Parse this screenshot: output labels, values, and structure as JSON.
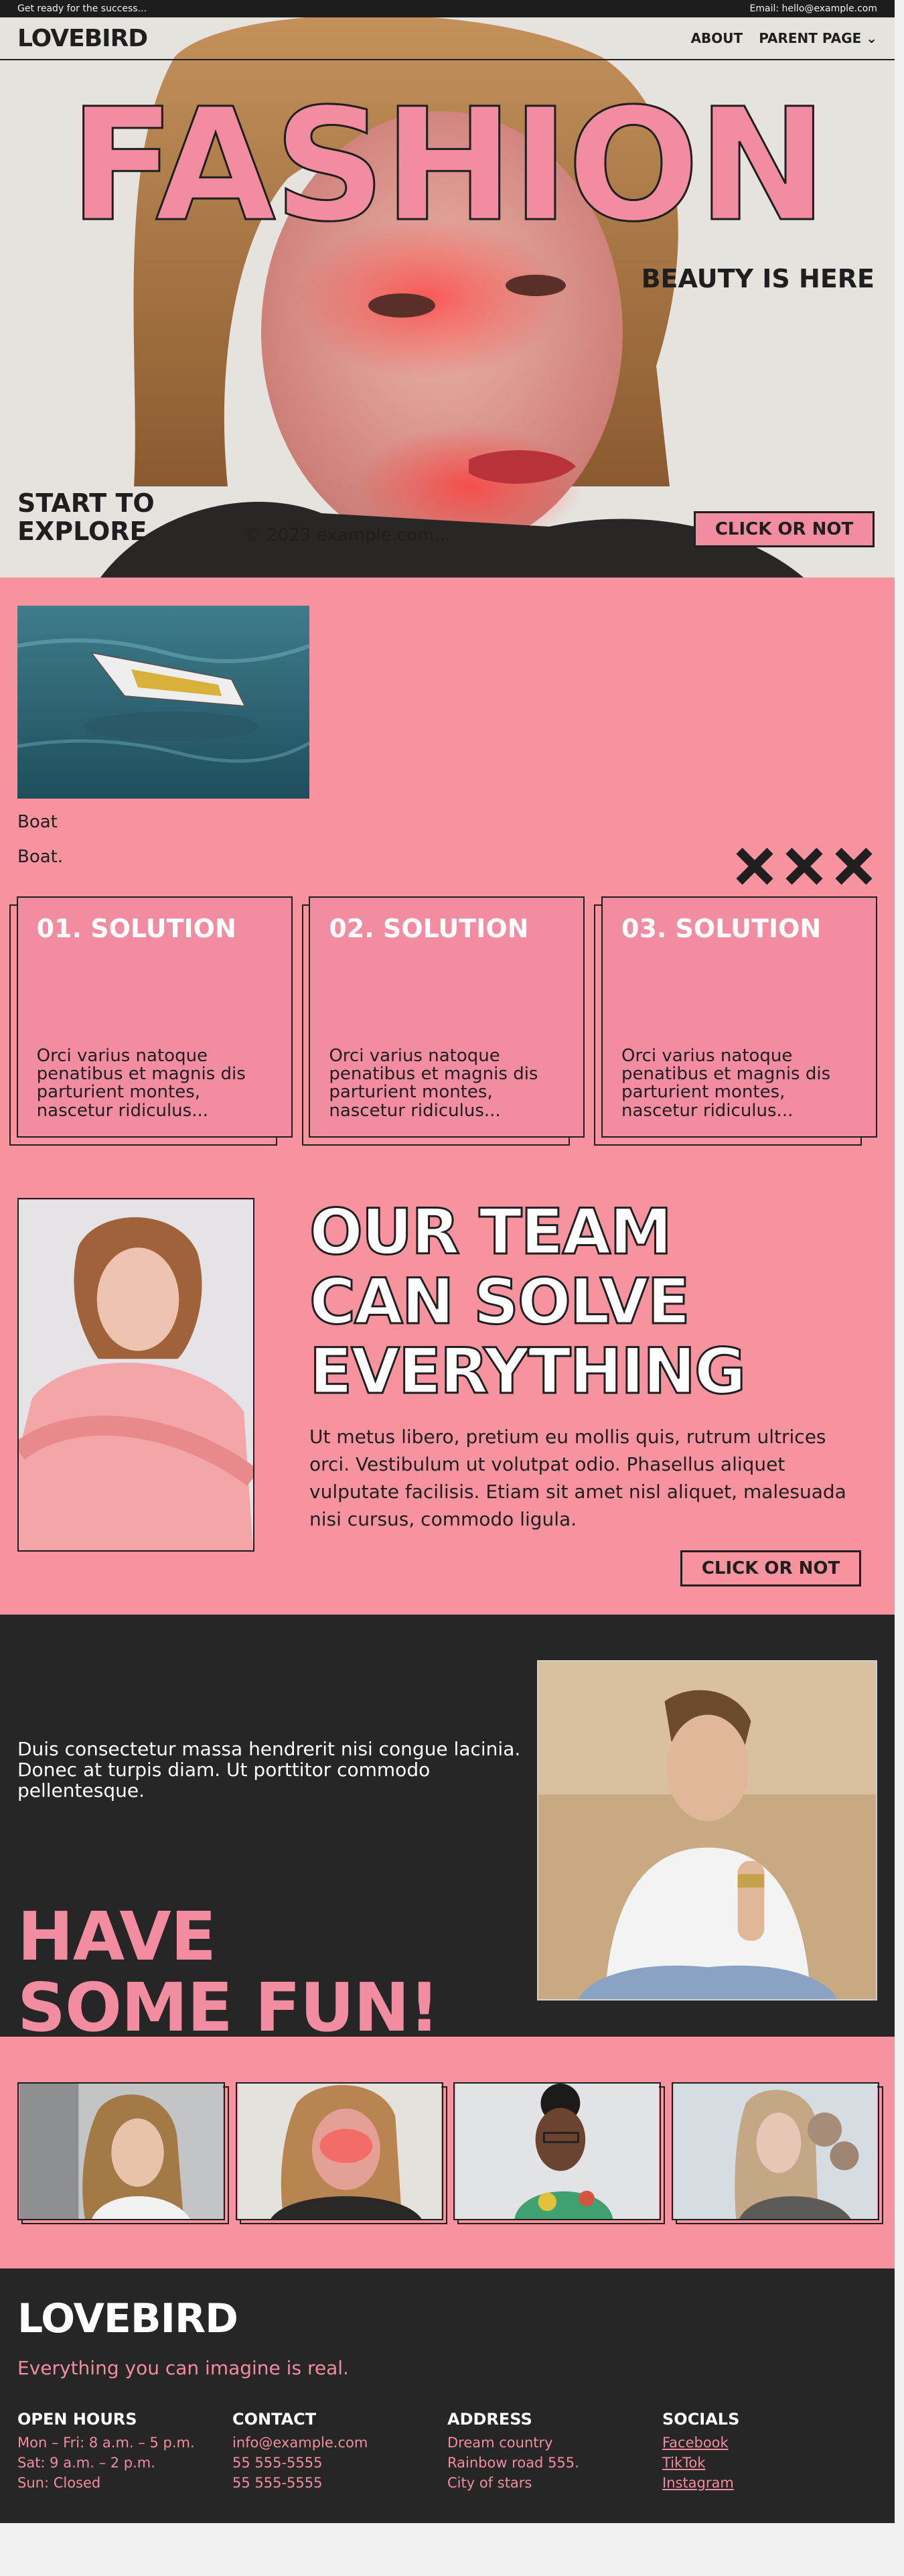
{
  "topbar": {
    "left": "Get ready for the success...",
    "right": "Email: hello@example.com"
  },
  "nav": {
    "logo": "LOVEBIRD",
    "about": "ABOUT",
    "parent": "PARENT PAGE ⌄"
  },
  "hero": {
    "headline": "FASHION",
    "subhead": "BEAUTY IS HERE",
    "start_line1": "START TO",
    "start_line2": "EXPLORE",
    "copyright": "© 2023 example.com...",
    "cta": "CLICK OR NOT"
  },
  "boat": {
    "title": "Boat",
    "caption": "Boat."
  },
  "cards": [
    {
      "title": "01. SOLUTION",
      "body": "Orci varius natoque penatibus et magnis dis parturient montes, nascetur ridiculus..."
    },
    {
      "title": "02. SOLUTION",
      "body": "Orci varius natoque penatibus et magnis dis parturient montes, nascetur ridiculus..."
    },
    {
      "title": "03. SOLUTION",
      "body": "Orci varius natoque penatibus et magnis dis parturient montes, nascetur ridiculus..."
    }
  ],
  "team": {
    "line1": "OUR TEAM",
    "line2": "CAN SOLVE",
    "line3": "EVERYTHING",
    "text": "Ut metus libero, pretium eu mollis quis, rutrum ultrices orci. Vestibulum ut volutpat odio. Phasellus aliquet vulputate facilisis. Etiam sit amet nisl aliquet, malesuada nisi cursus, commodo ligula.",
    "cta": "CLICK OR NOT"
  },
  "fun": {
    "text": "Duis consectetur massa hendrerit nisi congue lacinia. Donec at turpis diam. Ut porttitor commodo pellentesque.",
    "line1": "HAVE",
    "line2": "SOME FUN!"
  },
  "footer": {
    "logo": "LOVEBIRD",
    "tagline": "Everything you can imagine is real.",
    "hours": {
      "title": "OPEN HOURS",
      "l1": "Mon – Fri: 8 a.m. – 5 p.m.",
      "l2": "Sat: 9 a.m. – 2 p.m.",
      "l3": "Sun: Closed"
    },
    "contact": {
      "title": "CONTACT",
      "l1": "info@example.com",
      "l2": "55 555-5555",
      "l3": "55 555-5555"
    },
    "address": {
      "title": "ADDRESS",
      "l1": "Dream country",
      "l2": "Rainbow road 555.",
      "l3": "City of stars"
    },
    "socials": {
      "title": "SOCIALS",
      "l1": "Facebook",
      "l2": "TikTok",
      "l3": "Instagram"
    }
  },
  "colors": {
    "pink": "#f7929f",
    "pink_accent": "#f28ca0",
    "dark": "#262626",
    "ink": "#1f1f1f"
  }
}
